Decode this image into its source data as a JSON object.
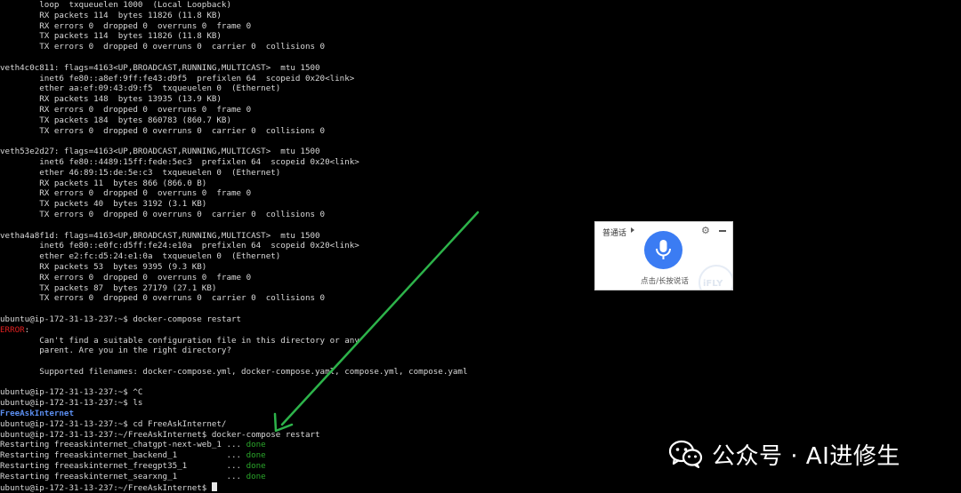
{
  "terminal": {
    "lines": [
      {
        "text": "        loop  txqueuelen 1000  (Local Loopback)"
      },
      {
        "text": "        RX packets 114  bytes 11826 (11.8 KB)"
      },
      {
        "text": "        RX errors 0  dropped 0  overruns 0  frame 0"
      },
      {
        "text": "        TX packets 114  bytes 11826 (11.8 KB)"
      },
      {
        "text": "        TX errors 0  dropped 0 overruns 0  carrier 0  collisions 0"
      },
      {
        "text": ""
      },
      {
        "text": "veth4c0c811: flags=4163<UP,BROADCAST,RUNNING,MULTICAST>  mtu 1500"
      },
      {
        "text": "        inet6 fe80::a8ef:9ff:fe43:d9f5  prefixlen 64  scopeid 0x20<link>"
      },
      {
        "text": "        ether aa:ef:09:43:d9:f5  txqueuelen 0  (Ethernet)"
      },
      {
        "text": "        RX packets 148  bytes 13935 (13.9 KB)"
      },
      {
        "text": "        RX errors 0  dropped 0  overruns 0  frame 0"
      },
      {
        "text": "        TX packets 184  bytes 860783 (860.7 KB)"
      },
      {
        "text": "        TX errors 0  dropped 0 overruns 0  carrier 0  collisions 0"
      },
      {
        "text": ""
      },
      {
        "text": "veth53e2d27: flags=4163<UP,BROADCAST,RUNNING,MULTICAST>  mtu 1500"
      },
      {
        "text": "        inet6 fe80::4489:15ff:fede:5ec3  prefixlen 64  scopeid 0x20<link>"
      },
      {
        "text": "        ether 46:89:15:de:5e:c3  txqueuelen 0  (Ethernet)"
      },
      {
        "text": "        RX packets 11  bytes 866 (866.0 B)"
      },
      {
        "text": "        RX errors 0  dropped 0  overruns 0  frame 0"
      },
      {
        "text": "        TX packets 40  bytes 3192 (3.1 KB)"
      },
      {
        "text": "        TX errors 0  dropped 0 overruns 0  carrier 0  collisions 0"
      },
      {
        "text": ""
      },
      {
        "text": "vetha4a8f1d: flags=4163<UP,BROADCAST,RUNNING,MULTICAST>  mtu 1500"
      },
      {
        "text": "        inet6 fe80::e0fc:d5ff:fe24:e10a  prefixlen 64  scopeid 0x20<link>"
      },
      {
        "text": "        ether e2:fc:d5:24:e1:0a  txqueuelen 0  (Ethernet)"
      },
      {
        "text": "        RX packets 53  bytes 9395 (9.3 KB)"
      },
      {
        "text": "        RX errors 0  dropped 0  overruns 0  frame 0"
      },
      {
        "text": "        TX packets 87  bytes 27179 (27.1 KB)"
      },
      {
        "text": "        TX errors 0  dropped 0 overruns 0  carrier 0  collisions 0"
      },
      {
        "text": ""
      },
      {
        "text": "ubuntu@ip-172-31-13-237:~$ docker-compose restart"
      },
      {
        "text": "ERROR",
        "suffix": ":",
        "style": "err"
      },
      {
        "text": "        Can't find a suitable configuration file in this directory or any"
      },
      {
        "text": "        parent. Are you in the right directory?"
      },
      {
        "text": ""
      },
      {
        "text": "        Supported filenames: docker-compose.yml, docker-compose.yaml, compose.yml, compose.yaml"
      },
      {
        "text": ""
      },
      {
        "text": "ubuntu@ip-172-31-13-237:~$ ^C"
      },
      {
        "text": "ubuntu@ip-172-31-13-237:~$ ls"
      },
      {
        "text": "FreeAskInternet",
        "style": "dir"
      },
      {
        "text": "ubuntu@ip-172-31-13-237:~$ cd FreeAskInternet/"
      },
      {
        "text": "ubuntu@ip-172-31-13-237:~/FreeAskInternet$ docker-compose restart"
      },
      {
        "text": "Restarting freeaskinternet_chatgpt-next-web_1 ... ",
        "status": "done"
      },
      {
        "text": "Restarting freeaskinternet_backend_1          ... ",
        "status": "done"
      },
      {
        "text": "Restarting freeaskinternet_freegpt35_1        ... ",
        "status": "done"
      },
      {
        "text": "Restarting freeaskinternet_searxng_1          ... ",
        "status": "done"
      },
      {
        "text": "ubuntu@ip-172-31-13-237:~/FreeAskInternet$ ",
        "cursor": true
      }
    ]
  },
  "voice_widget": {
    "mode_label": "普通话",
    "hint": "点击/长按说话",
    "brand": "iFLY",
    "icons": [
      "gear-icon",
      "minimize-icon",
      "microphone-icon"
    ],
    "accent_color": "#3b7cf3"
  },
  "watermark": {
    "text": "公众号 · AI进修生",
    "icon": "wechat-icon"
  },
  "annotation": {
    "color": "#2db34a"
  }
}
